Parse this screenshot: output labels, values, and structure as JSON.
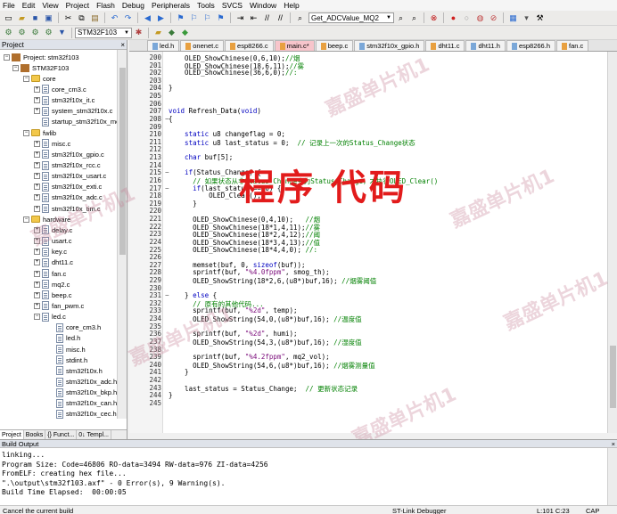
{
  "menu": [
    "File",
    "Edit",
    "View",
    "Project",
    "Flash",
    "Debug",
    "Peripherals",
    "Tools",
    "SVCS",
    "Window",
    "Help"
  ],
  "toolbar": {
    "target_combo": "Get_ADCValue_MQ2",
    "project_combo": "STM32F103"
  },
  "project_panel": {
    "title": "Project",
    "close_glyph": "×",
    "tree": [
      {
        "label": "Project: stm32f103",
        "depth": 0,
        "kind": "root",
        "pm": "−"
      },
      {
        "label": "STM32F103",
        "depth": 1,
        "kind": "root",
        "pm": "−"
      },
      {
        "label": "core",
        "depth": 2,
        "kind": "folder",
        "pm": "−"
      },
      {
        "label": "core_cm3.c",
        "depth": 3,
        "kind": "file",
        "pm": "+"
      },
      {
        "label": "stm32f10x_it.c",
        "depth": 3,
        "kind": "file",
        "pm": "+"
      },
      {
        "label": "system_stm32f10x.c",
        "depth": 3,
        "kind": "file",
        "pm": "+"
      },
      {
        "label": "startup_stm32f10x_md.s",
        "depth": 3,
        "kind": "file",
        "pm": ""
      },
      {
        "label": "fwlib",
        "depth": 2,
        "kind": "folder",
        "pm": "−"
      },
      {
        "label": "misc.c",
        "depth": 3,
        "kind": "file",
        "pm": "+"
      },
      {
        "label": "stm32f10x_gpio.c",
        "depth": 3,
        "kind": "file",
        "pm": "+"
      },
      {
        "label": "stm32f10x_rcc.c",
        "depth": 3,
        "kind": "file",
        "pm": "+"
      },
      {
        "label": "stm32f10x_usart.c",
        "depth": 3,
        "kind": "file",
        "pm": "+"
      },
      {
        "label": "stm32f10x_exti.c",
        "depth": 3,
        "kind": "file",
        "pm": "+"
      },
      {
        "label": "stm32f10x_adc.c",
        "depth": 3,
        "kind": "file",
        "pm": "+"
      },
      {
        "label": "stm32f10x_tim.c",
        "depth": 3,
        "kind": "file",
        "pm": "+"
      },
      {
        "label": "hardware",
        "depth": 2,
        "kind": "folder",
        "pm": "−"
      },
      {
        "label": "delay.c",
        "depth": 3,
        "kind": "file",
        "pm": "+"
      },
      {
        "label": "usart.c",
        "depth": 3,
        "kind": "file",
        "pm": "+"
      },
      {
        "label": "key.c",
        "depth": 3,
        "kind": "file",
        "pm": "+"
      },
      {
        "label": "dht11.c",
        "depth": 3,
        "kind": "file",
        "pm": "+"
      },
      {
        "label": "fan.c",
        "depth": 3,
        "kind": "file",
        "pm": "+"
      },
      {
        "label": "mq2.c",
        "depth": 3,
        "kind": "file",
        "pm": "+"
      },
      {
        "label": "beep.c",
        "depth": 3,
        "kind": "file",
        "pm": "+"
      },
      {
        "label": "fan_pwm.c",
        "depth": 3,
        "kind": "file",
        "pm": "+"
      },
      {
        "label": "led.c",
        "depth": 3,
        "kind": "file",
        "pm": "−"
      },
      {
        "label": "core_cm3.h",
        "depth": 4,
        "kind": "file",
        "pm": ""
      },
      {
        "label": "led.h",
        "depth": 4,
        "kind": "file",
        "pm": ""
      },
      {
        "label": "misc.h",
        "depth": 4,
        "kind": "file",
        "pm": ""
      },
      {
        "label": "stdint.h",
        "depth": 4,
        "kind": "file",
        "pm": ""
      },
      {
        "label": "stm32f10x.h",
        "depth": 4,
        "kind": "file",
        "pm": ""
      },
      {
        "label": "stm32f10x_adc.h",
        "depth": 4,
        "kind": "file",
        "pm": ""
      },
      {
        "label": "stm32f10x_bkp.h",
        "depth": 4,
        "kind": "file",
        "pm": ""
      },
      {
        "label": "stm32f10x_can.h",
        "depth": 4,
        "kind": "file",
        "pm": ""
      },
      {
        "label": "stm32f10x_cec.h",
        "depth": 4,
        "kind": "file",
        "pm": ""
      },
      {
        "label": "stm32f10x_conf.h",
        "depth": 4,
        "kind": "file",
        "pm": ""
      },
      {
        "label": "stm32f10x_crc.h",
        "depth": 4,
        "kind": "file",
        "pm": ""
      },
      {
        "label": "stm32f10x_dac.h",
        "depth": 4,
        "kind": "file",
        "pm": ""
      }
    ],
    "bottom_tabs": [
      "Project",
      "Books",
      "{} Funct...",
      "0↓ Templ..."
    ]
  },
  "editor": {
    "tabs": [
      {
        "label": "led.h",
        "color": "#7aa7d8",
        "active": false
      },
      {
        "label": "onenet.c",
        "color": "#e8a040",
        "active": false
      },
      {
        "label": "esp8266.c",
        "color": "#e8a040",
        "active": false
      },
      {
        "label": "main.c*",
        "color": "#e8a040",
        "active": true
      },
      {
        "label": "beep.c",
        "color": "#e8a040",
        "active": false
      },
      {
        "label": "stm32f10x_gpio.h",
        "color": "#7aa7d8",
        "active": false
      },
      {
        "label": "dht11.c",
        "color": "#e8a040",
        "active": false
      },
      {
        "label": "dht11.h",
        "color": "#7aa7d8",
        "active": false
      },
      {
        "label": "esp8266.h",
        "color": "#7aa7d8",
        "active": false
      },
      {
        "label": "fan.c",
        "color": "#e8a040",
        "active": false
      }
    ],
    "lines": [
      {
        "n": "200",
        "t": [
          [
            "    OLED_ShowChinese(0,6,10);",
            "nm"
          ],
          [
            "//烟",
            "cm"
          ]
        ]
      },
      {
        "n": "201",
        "t": [
          [
            "    OLED_ShowChinese(18,6,11);",
            "nm"
          ],
          [
            "//雾",
            "cm"
          ]
        ]
      },
      {
        "n": "202",
        "t": [
          [
            "    OLED_ShowChinese(36,6,0);",
            "nm"
          ],
          [
            "//:",
            "cm"
          ]
        ]
      },
      {
        "n": "203",
        "t": []
      },
      {
        "n": "204",
        "t": [
          [
            "}",
            "nm"
          ]
        ]
      },
      {
        "n": "205",
        "t": []
      },
      {
        "n": "206",
        "t": []
      },
      {
        "n": "207",
        "t": [
          [
            "void ",
            "kw"
          ],
          [
            "Refresh_Data(",
            "nm"
          ],
          [
            "void",
            "kw"
          ],
          [
            ")",
            "nm"
          ]
        ]
      },
      {
        "n": "208",
        "t": [
          [
            "{",
            "nm"
          ]
        ],
        "fold": "−"
      },
      {
        "n": "209",
        "t": []
      },
      {
        "n": "210",
        "t": [
          [
            "    static ",
            "kw"
          ],
          [
            "u8 changeflag = 0;",
            "nm"
          ]
        ]
      },
      {
        "n": "211",
        "t": [
          [
            "    static ",
            "kw"
          ],
          [
            "u8 last_status = 0;  ",
            "nm"
          ],
          [
            "// 记录上一次的Status_Change状态",
            "cm"
          ]
        ]
      },
      {
        "n": "212",
        "t": []
      },
      {
        "n": "213",
        "t": [
          [
            "    char ",
            "kw"
          ],
          [
            "buf[5];",
            "nm"
          ]
        ]
      },
      {
        "n": "214",
        "t": []
      },
      {
        "n": "215",
        "t": [
          [
            "    if",
            "kw"
          ],
          [
            "(Status_Change) {",
            "nm"
          ]
        ],
        "fold": "−"
      },
      {
        "n": "216",
        "t": [
          [
            "      // 如果状态从非Status_Change变为Status_Change，才执行OLED_Clear()",
            "cm"
          ]
        ]
      },
      {
        "n": "217",
        "t": [
          [
            "      if",
            "kw"
          ],
          [
            "(last_status == 0) {",
            "nm"
          ]
        ],
        "fold": "−"
      },
      {
        "n": "218",
        "t": [
          [
            "          OLED_Clear();",
            "nm"
          ]
        ]
      },
      {
        "n": "219",
        "t": [
          [
            "      }",
            "nm"
          ]
        ]
      },
      {
        "n": "220",
        "t": []
      },
      {
        "n": "221",
        "t": [
          [
            "      OLED_ShowChinese(0,4,10);   ",
            "nm"
          ],
          [
            "//烟",
            "cm"
          ]
        ]
      },
      {
        "n": "222",
        "t": [
          [
            "      OLED_ShowChinese(18*1,4,11);",
            "nm"
          ],
          [
            "//雾",
            "cm"
          ]
        ]
      },
      {
        "n": "223",
        "t": [
          [
            "      OLED_ShowChinese(18*2,4,12);",
            "nm"
          ],
          [
            "//阈",
            "cm"
          ]
        ]
      },
      {
        "n": "224",
        "t": [
          [
            "      OLED_ShowChinese(18*3,4,13);",
            "nm"
          ],
          [
            "//值",
            "cm"
          ]
        ]
      },
      {
        "n": "225",
        "t": [
          [
            "      OLED_ShowChinese(18*4,4,0); ",
            "nm"
          ],
          [
            "//:",
            "cm"
          ]
        ]
      },
      {
        "n": "226",
        "t": []
      },
      {
        "n": "227",
        "t": [
          [
            "      memset(buf, 0, ",
            "nm"
          ],
          [
            "sizeof",
            "kw"
          ],
          [
            "(buf));",
            "nm"
          ]
        ]
      },
      {
        "n": "228",
        "t": [
          [
            "      sprintf(buf, ",
            "nm"
          ],
          [
            "\"%4.0fppm\"",
            "st"
          ],
          [
            ", smog_th);",
            "nm"
          ]
        ]
      },
      {
        "n": "229",
        "t": [
          [
            "      OLED_ShowString(18*2,6,(u8*)buf,16); ",
            "nm"
          ],
          [
            "//烟雾阈值",
            "cm"
          ]
        ]
      },
      {
        "n": "230",
        "t": []
      },
      {
        "n": "231",
        "t": [
          [
            "    } ",
            "nm"
          ],
          [
            "else ",
            "kw"
          ],
          [
            "{",
            "nm"
          ]
        ],
        "fold": "−"
      },
      {
        "n": "232",
        "t": [
          [
            "      // 原有的其他代码...",
            "cm"
          ]
        ]
      },
      {
        "n": "233",
        "t": [
          [
            "      sprintf(buf, ",
            "nm"
          ],
          [
            "\"%2d\"",
            "st"
          ],
          [
            ", temp);",
            "nm"
          ]
        ]
      },
      {
        "n": "234",
        "t": [
          [
            "      OLED_ShowString(54,0,(u8*)buf,16); ",
            "nm"
          ],
          [
            "//温度值",
            "cm"
          ]
        ]
      },
      {
        "n": "235",
        "t": []
      },
      {
        "n": "236",
        "t": [
          [
            "      sprintf(buf, ",
            "nm"
          ],
          [
            "\"%2d\"",
            "st"
          ],
          [
            ", humi);",
            "nm"
          ]
        ]
      },
      {
        "n": "237",
        "t": [
          [
            "      OLED_ShowString(54,3,(u8*)buf,16); ",
            "nm"
          ],
          [
            "//湿度值",
            "cm"
          ]
        ]
      },
      {
        "n": "238",
        "t": []
      },
      {
        "n": "239",
        "t": [
          [
            "      sprintf(buf, ",
            "nm"
          ],
          [
            "\"%4.2fppm\"",
            "st"
          ],
          [
            ", mq2_vol);",
            "nm"
          ]
        ]
      },
      {
        "n": "240",
        "t": [
          [
            "      OLED_ShowString(54,6,(u8*)buf,16); ",
            "nm"
          ],
          [
            "//烟雾测量值",
            "cm"
          ]
        ]
      },
      {
        "n": "241",
        "t": [
          [
            "    }",
            "nm"
          ]
        ]
      },
      {
        "n": "242",
        "t": []
      },
      {
        "n": "243",
        "t": [
          [
            "    last_status = Status_Change;  ",
            "nm"
          ],
          [
            "// 更新状态记录",
            "cm"
          ]
        ]
      },
      {
        "n": "244",
        "t": [
          [
            "}",
            "nm"
          ]
        ]
      },
      {
        "n": "245",
        "t": []
      }
    ],
    "overlay_text": "程序 代码",
    "watermarks": [
      "嘉盛单片机1",
      "嘉盛单片机1",
      "嘉盛单片机1",
      "嘉盛单片机1",
      "嘉盛单片机1",
      "嘉盛单片机1"
    ]
  },
  "build_output": {
    "title": "Build Output",
    "close_glyph": "×",
    "lines": [
      "linking...",
      "Program Size: Code=46806 RO-data=3494 RW-data=976 ZI-data=4256",
      "FromELF: creating hex file...",
      "\".\\output\\stm32f103.axf\" - 0 Error(s), 9 Warning(s).",
      "Build Time Elapsed:  00:00:05"
    ]
  },
  "status_bar": {
    "left": "Cancel the current build",
    "debugger": "ST-Link Debugger",
    "position": "L:101 C:23",
    "caps": "CAP"
  },
  "colors": {
    "accent_red": "#e21b1b",
    "active_tab": "#f7c5cb"
  }
}
